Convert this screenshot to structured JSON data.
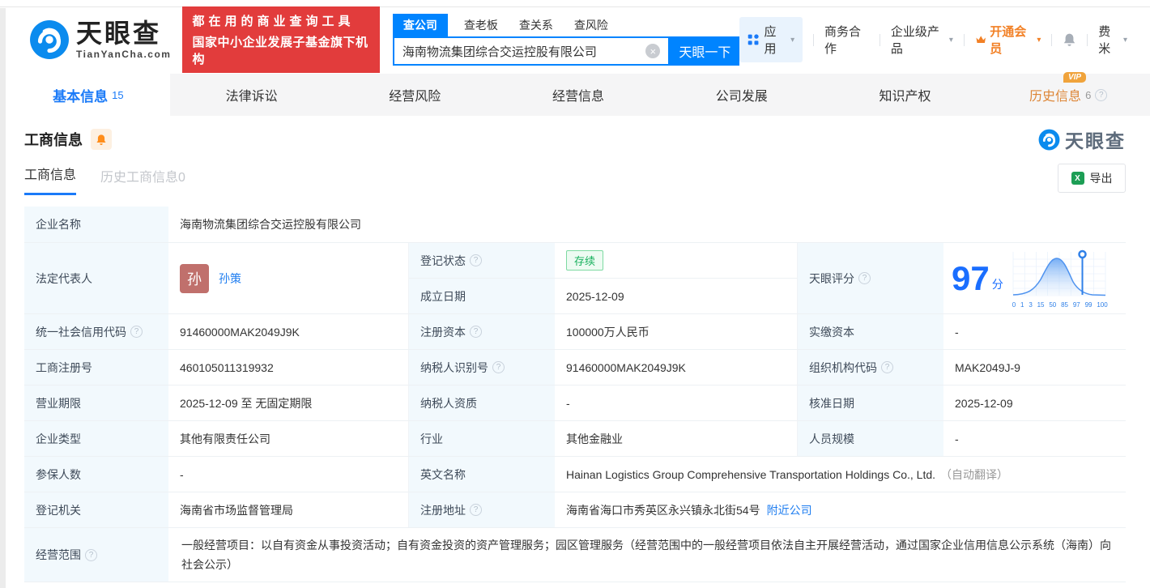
{
  "brand": {
    "name": "天眼查",
    "domain": "TianYanCha.com",
    "slogan_line1": "都在用的商业查询工具",
    "slogan_line2": "国家中小企业发展子基金旗下机构"
  },
  "search": {
    "tabs": [
      "查公司",
      "查老板",
      "查关系",
      "查风险"
    ],
    "value": "海南物流集团综合交运控股有限公司",
    "button": "天眼一下"
  },
  "menu": {
    "apps": "应用",
    "cooperation": "商务合作",
    "enterprise": "企业级产品",
    "vip": "开通会员",
    "vip_badge": "VIP",
    "user": "费米"
  },
  "nav": {
    "tabs": [
      {
        "label": "基本信息",
        "count": "15"
      },
      {
        "label": "法律诉讼"
      },
      {
        "label": "经营风险"
      },
      {
        "label": "经营信息"
      },
      {
        "label": "公司发展"
      },
      {
        "label": "知识产权"
      },
      {
        "label": "历史信息",
        "count": "6",
        "badge": "VIP"
      }
    ]
  },
  "section": {
    "title": "工商信息",
    "watermark": "天眼查",
    "tabs": [
      "工商信息",
      "历史工商信息0"
    ],
    "export_label": "导出"
  },
  "fields": {
    "company_name": {
      "label": "企业名称",
      "value": "海南物流集团综合交运控股有限公司"
    },
    "legal_rep": {
      "label": "法定代表人",
      "avatar": "孙",
      "name": "孙策"
    },
    "reg_status": {
      "label": "登记状态",
      "value": "存续"
    },
    "establish_date": {
      "label": "成立日期",
      "value": "2025-12-09"
    },
    "tyc_score": {
      "label": "天眼评分",
      "score": "97",
      "unit": "分"
    },
    "credit_code": {
      "label": "统一社会信用代码",
      "value": "91460000MAK2049J9K"
    },
    "reg_capital": {
      "label": "注册资本",
      "value": "100000万人民币"
    },
    "paid_capital": {
      "label": "实缴资本",
      "value": "-"
    },
    "reg_number": {
      "label": "工商注册号",
      "value": "460105011319932"
    },
    "taxpayer_id": {
      "label": "纳税人识别号",
      "value": "91460000MAK2049J9K"
    },
    "org_code": {
      "label": "组织机构代码",
      "value": "MAK2049J-9"
    },
    "business_term": {
      "label": "营业期限",
      "value": "2025-12-09 至 无固定期限"
    },
    "taxpayer_quality": {
      "label": "纳税人资质",
      "value": "-"
    },
    "approval_date": {
      "label": "核准日期",
      "value": "2025-12-09"
    },
    "company_type": {
      "label": "企业类型",
      "value": "其他有限责任公司"
    },
    "industry": {
      "label": "行业",
      "value": "其他金融业"
    },
    "staff_size": {
      "label": "人员规模",
      "value": "-"
    },
    "insured_count": {
      "label": "参保人数",
      "value": "-"
    },
    "english_name": {
      "label": "英文名称",
      "value": "Hainan Logistics Group Comprehensive Transportation Holdings Co., Ltd.",
      "note": "（自动翻译）"
    },
    "reg_authority": {
      "label": "登记机关",
      "value": "海南省市场监督管理局"
    },
    "reg_address": {
      "label": "注册地址",
      "value": "海南省海口市秀英区永兴镇永北街54号",
      "link": "附近公司"
    },
    "business_scope": {
      "label": "经营范围",
      "value": "一般经营项目：以自有资金从事投资活动；自有资金投资的资产管理服务；园区管理服务（经营范围中的一般经营项目依法自主开展经营活动，通过国家企业信用信息公示系统（海南）向社会公示）"
    }
  },
  "chart_data": {
    "type": "area",
    "title": "天眼评分",
    "score": 97,
    "unit": "分",
    "x_ticks": [
      "0",
      "1",
      "3",
      "15",
      "50",
      "85",
      "97",
      "99",
      "100"
    ],
    "marker_at": "97",
    "shape": "normal-distribution-curve",
    "accent_color": "#2f80e8"
  }
}
